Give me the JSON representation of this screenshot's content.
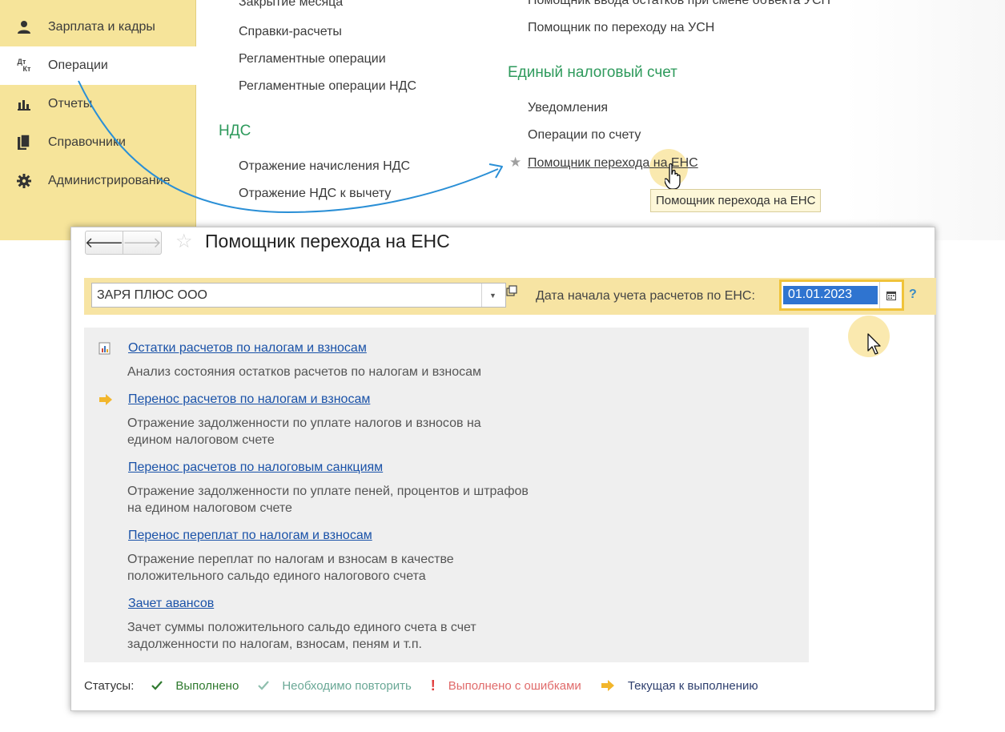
{
  "sidebar": {
    "items": [
      {
        "label": "Зарплата и кадры",
        "icon": "person-icon"
      },
      {
        "label": "Операции",
        "icon": "dt-kt-icon"
      },
      {
        "label": "Отчеты",
        "icon": "bar-chart-icon"
      },
      {
        "label": "Справочники",
        "icon": "books-icon"
      },
      {
        "label": "Администрирование",
        "icon": "gear-icon"
      }
    ],
    "active_index": 1,
    "dt_glyph": "Дт",
    "kt_glyph": "Кт"
  },
  "menu": {
    "col1": {
      "items": [
        "Закрытие месяца",
        "Справки-расчеты",
        "Регламентные операции",
        "Регламентные операции НДС"
      ],
      "vat_section": "НДС",
      "vat_items": [
        "Отражение начисления НДС",
        "Отражение НДС к вычету"
      ]
    },
    "col2": {
      "items": [
        "Помощник ввода остатков при смене объекта УСН",
        "Помощник по переходу на УСН"
      ],
      "ens_section": "Единый налоговый счет",
      "ens_items": [
        "Уведомления",
        "Операции по счету",
        "Помощник перехода на ЕНС"
      ]
    },
    "tooltip": "Помощник перехода на ЕНС"
  },
  "window": {
    "title": "Помощник перехода на ЕНС",
    "back_glyph": "🡐",
    "forward_glyph": "🡒",
    "star_glyph": "☆",
    "organization": "ЗАРЯ ПЛЮС ООО",
    "date_label": "Дата начала учета расчетов по ЕНС:",
    "date_value": "01.01.2023",
    "help_glyph": "?",
    "dropdown_glyph": "▼",
    "steps": [
      {
        "link": "Остатки расчетов по налогам и взносам",
        "desc": [
          "Анализ состояния остатков расчетов по налогам и взносам"
        ],
        "icon": "report-icon"
      },
      {
        "link": "Перенос расчетов по налогам и взносам",
        "desc": [
          "Отражение задолженности по уплате налогов и взносов на",
          "едином налоговом счете"
        ],
        "icon": "current-arrow-icon"
      },
      {
        "link": "Перенос расчетов по налоговым санкциям",
        "desc": [
          "Отражение задолженности по уплате пеней, процентов и штрафов",
          "на едином налоговом счете"
        ],
        "icon": ""
      },
      {
        "link": "Перенос переплат по налогам и взносам",
        "desc": [
          "Отражение переплат по налогам и взносам в качестве",
          "положительного сальдо единого налогового счета"
        ],
        "icon": ""
      },
      {
        "link": "Зачет авансов",
        "desc": [
          "Зачет суммы положительного сальдо единого счета в счет",
          "задолженности по налогам, взносам, пеням и т.п."
        ],
        "icon": ""
      }
    ],
    "statuses": {
      "label": "Статусы:",
      "done": "Выполнено",
      "repeat": "Необходимо повторить",
      "error": "Выполнено с ошибками",
      "current": "Текущая к выполнению",
      "error_glyph": "!"
    }
  },
  "colors": {
    "sidebar_bg": "#f6e49a",
    "section_green": "#2e9a5c",
    "link_blue": "#1a52a8",
    "date_highlight": "#2f74d0",
    "annotation_arrow": "#2a8fd6"
  }
}
